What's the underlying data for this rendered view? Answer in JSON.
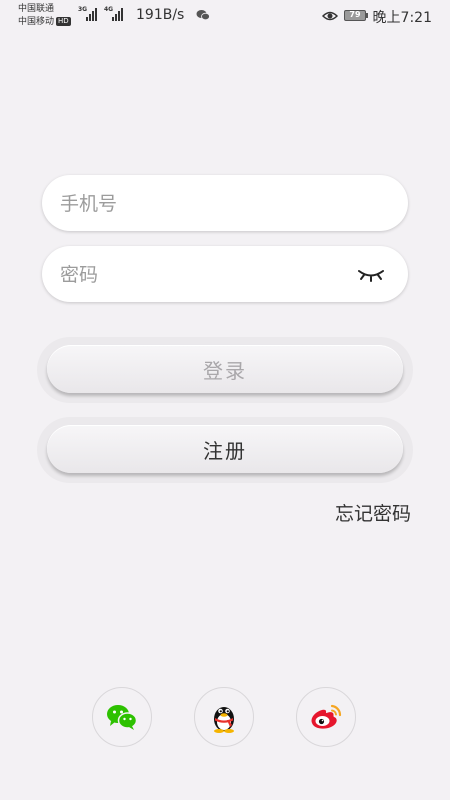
{
  "status_bar": {
    "carrier_1": "中国联通",
    "carrier_2": "中国移动",
    "hd_badge": "HD",
    "signal_1_gen": "3G",
    "signal_2_gen": "4G",
    "net_speed": "191B/s",
    "battery_level": "79",
    "time": "晚上7:21"
  },
  "login_form": {
    "phone_placeholder": "手机号",
    "password_placeholder": "密码",
    "login_label": "登录",
    "register_label": "注册",
    "forgot_password": "忘记密码"
  },
  "social_icons": [
    "wechat-icon",
    "qq-icon",
    "weibo-icon"
  ],
  "colors": {
    "background": "#f3f1f4",
    "wechat": "#2dc100",
    "weibo": "#e6162d",
    "qq_scarf": "#e8322c"
  }
}
